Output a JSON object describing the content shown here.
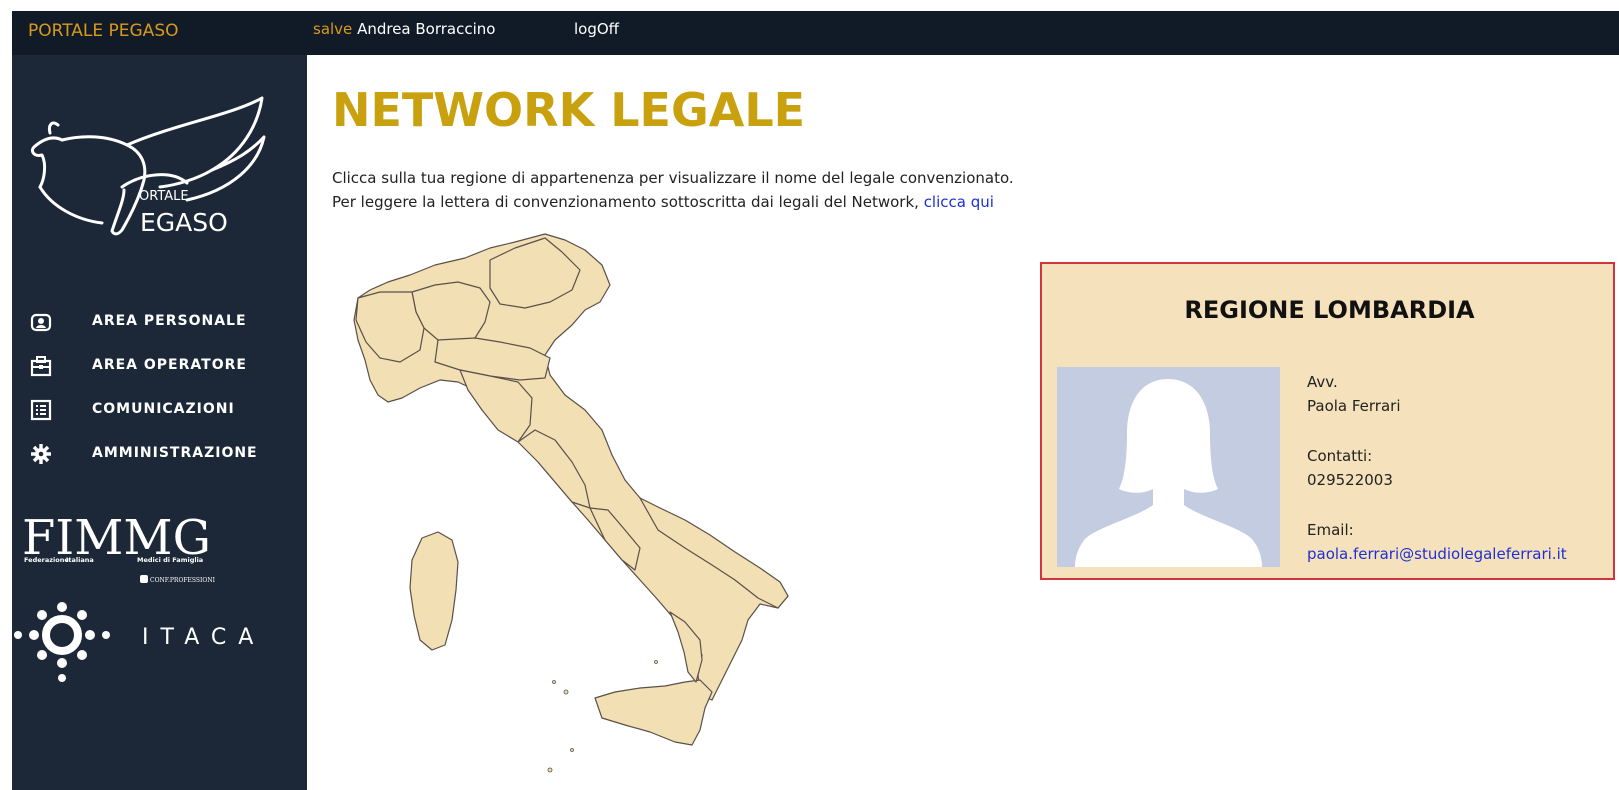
{
  "header": {
    "brand": "PORTALE PEGASO",
    "greeting_prefix": "salve",
    "user_name": "Andrea Borraccino",
    "logoff_label": "logOff"
  },
  "sidebar": {
    "logo_text_top": "ORTALE",
    "logo_text_bottom": "EGASO",
    "items": [
      {
        "label": "AREA PERSONALE",
        "icon": "user-card-icon"
      },
      {
        "label": "AREA OPERATORE",
        "icon": "briefcase-icon"
      },
      {
        "label": "COMUNICAZIONI",
        "icon": "document-list-icon"
      },
      {
        "label": "AMMINISTRAZIONE",
        "icon": "gear-icon"
      }
    ],
    "fimmg_logo": {
      "big": "FIMMG",
      "line1a": "Federazione",
      "line1b": "Italiana",
      "line1c": "Medici di Famiglia",
      "partner": "CONF.PROFESSIONI"
    },
    "itaca_logo": "ITACA"
  },
  "main": {
    "title": "NETWORK LEGALE",
    "intro_line1": "Clicca sulla tua regione di appartenenza per visualizzare il nome del legale convenzionato.",
    "intro_line2": "Per leggere la lettera di convenzionamento sottoscritta dai legali del Network,",
    "intro_link": "clicca qui"
  },
  "region_card": {
    "title": "REGIONE LOMBARDIA",
    "role": "Avv.",
    "name": "Paola Ferrari",
    "contacts_label": "Contatti:",
    "phone": "029522003",
    "email_label": "Email:",
    "email": "paola.ferrari@studiolegaleferrari.it"
  },
  "colors": {
    "topbar": "#111b27",
    "sidebar": "#1c2838",
    "accent": "#c9a00e",
    "map_fill": "#f2dfb4",
    "card_bg": "#f5e2bc",
    "card_border": "#d2343a",
    "link": "#1e2fd6"
  }
}
